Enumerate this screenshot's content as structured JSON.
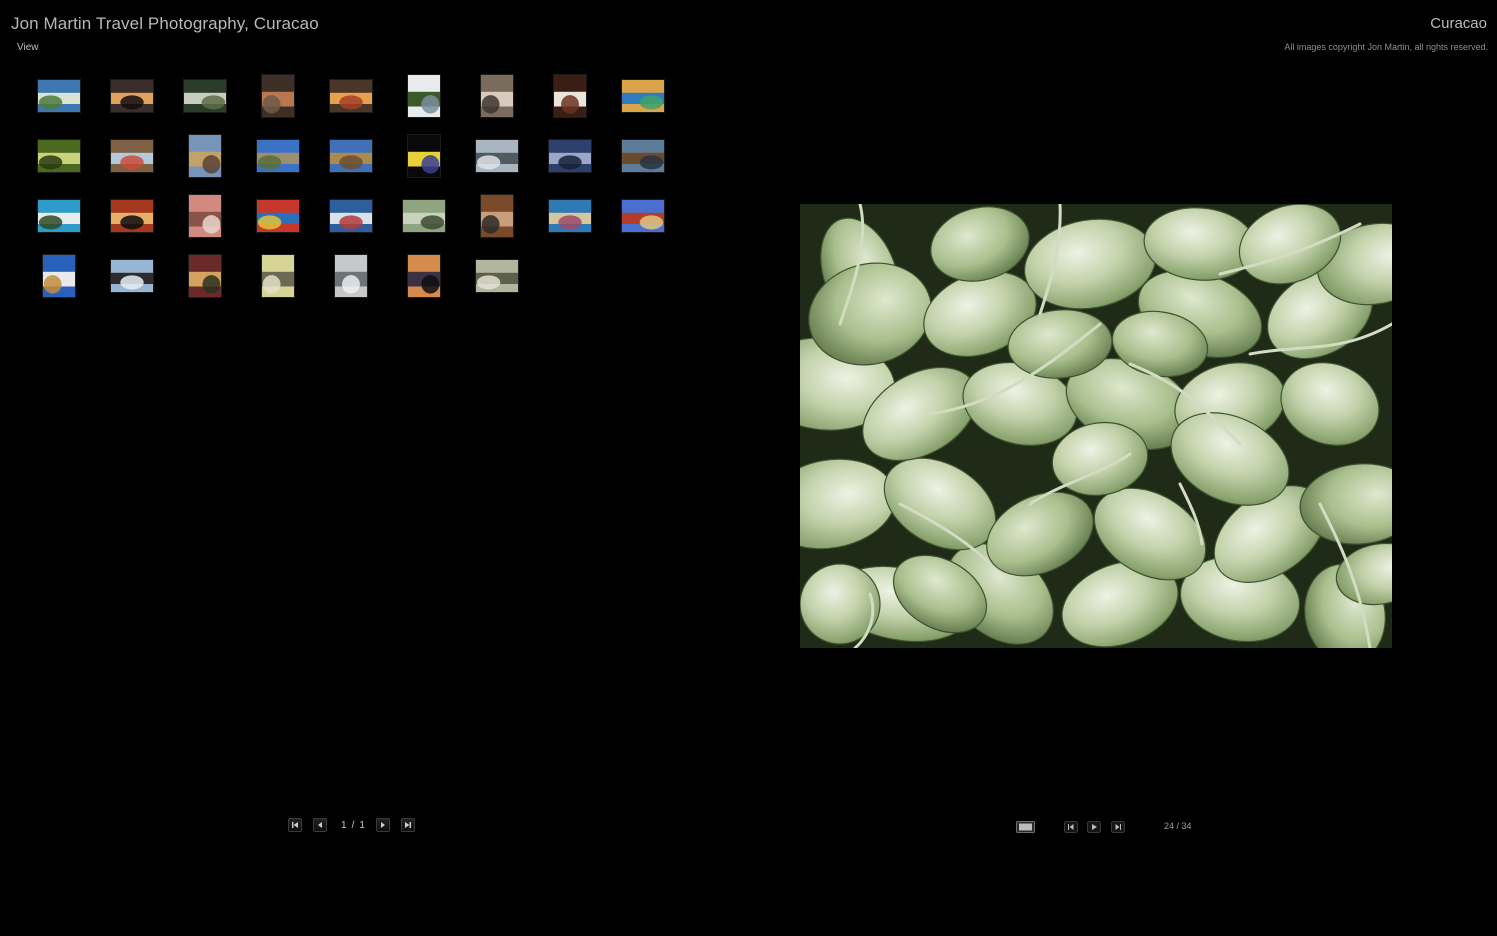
{
  "header": {
    "site_title": "Jon Martin Travel Photography, Curacao",
    "view_menu": "View",
    "gallery_title": "Curacao",
    "copyright": "All images copyright Jon Martin, all rights reserved."
  },
  "grid_pager": {
    "current_page": "1",
    "separator": "/",
    "total_pages": "1",
    "first_icon": "first-page-icon",
    "prev_icon": "previous-page-icon",
    "next_icon": "next-page-icon",
    "last_icon": "last-page-icon"
  },
  "viewer": {
    "counter": "24 / 34",
    "selected_index": 24,
    "total": 34,
    "mode_icon": "single-image-view-icon",
    "prev_icon": "previous-image-icon",
    "play_icon": "play-slideshow-icon",
    "next_icon": "next-image-icon"
  },
  "thumbnails": [
    {
      "shape": "landscape",
      "palette": [
        "#3f77b3",
        "#d9e4d0",
        "#4e7a3a"
      ]
    },
    {
      "shape": "landscape",
      "palette": [
        "#3a2e2c",
        "#e3a25b",
        "#120d0c"
      ]
    },
    {
      "shape": "landscape",
      "palette": [
        "#2c3c2a",
        "#c7cdbd",
        "#5d6b47"
      ]
    },
    {
      "shape": "portrait",
      "palette": [
        "#3d2f25",
        "#b9764f",
        "#6f5a48"
      ]
    },
    {
      "shape": "landscape",
      "palette": [
        "#4a3628",
        "#e6a14a",
        "#a63e2a"
      ]
    },
    {
      "shape": "portrait",
      "palette": [
        "#e8ebee",
        "#3b5a2c",
        "#7a8f9c"
      ]
    },
    {
      "shape": "portrait",
      "palette": [
        "#7a6b5c",
        "#d8cbbd",
        "#3f352e"
      ]
    },
    {
      "shape": "portrait",
      "palette": [
        "#3a1e16",
        "#e9e4dc",
        "#6b3322"
      ]
    },
    {
      "shape": "landscape",
      "palette": [
        "#d9a44a",
        "#2f7bbd",
        "#3da36b"
      ]
    },
    {
      "shape": "landscape",
      "palette": [
        "#4b6a1f",
        "#c9d37c",
        "#2a3a12"
      ]
    },
    {
      "shape": "landscape",
      "palette": [
        "#7e6045",
        "#b5c9db",
        "#c94b3a"
      ]
    },
    {
      "shape": "portrait",
      "palette": [
        "#7895b9",
        "#c3a26a",
        "#5b4333"
      ]
    },
    {
      "shape": "landscape",
      "palette": [
        "#3c72c6",
        "#9a8e73",
        "#5b6d3a"
      ]
    },
    {
      "shape": "landscape",
      "palette": [
        "#4071b8",
        "#a88a52",
        "#6b4f2c"
      ]
    },
    {
      "shape": "portrait",
      "palette": [
        "#090909",
        "#e7d23a",
        "#3a3e8f"
      ]
    },
    {
      "shape": "landscape",
      "palette": [
        "#a9b6c2",
        "#4f5a63",
        "#dfe3e6"
      ]
    },
    {
      "shape": "landscape",
      "palette": [
        "#2d3f6b",
        "#9aa7c8",
        "#18203a"
      ]
    },
    {
      "shape": "landscape",
      "palette": [
        "#5d7c99",
        "#6b4a2e",
        "#2a3341"
      ]
    },
    {
      "shape": "landscape",
      "palette": [
        "#2f9bc8",
        "#e6ecec",
        "#2d4a26"
      ]
    },
    {
      "shape": "landscape",
      "palette": [
        "#a4391f",
        "#e7b066",
        "#0d0d0d"
      ]
    },
    {
      "shape": "portrait",
      "palette": [
        "#d28a80",
        "#8a5348",
        "#e9d5cc"
      ]
    },
    {
      "shape": "landscape",
      "palette": [
        "#c7382c",
        "#2b6fb9",
        "#e0c33c"
      ]
    },
    {
      "shape": "landscape",
      "palette": [
        "#2c5f9b",
        "#d7e2ea",
        "#b23c3c"
      ]
    },
    {
      "shape": "landscape",
      "palette": [
        "#8fa57f",
        "#c8d3bb",
        "#3d4a32"
      ]
    },
    {
      "shape": "portrait",
      "palette": [
        "#7a4a2b",
        "#c7a07b",
        "#2c2a28"
      ]
    },
    {
      "shape": "landscape",
      "palette": [
        "#2f79b6",
        "#d7c79f",
        "#9a4a6b"
      ]
    },
    {
      "shape": "landscape",
      "palette": [
        "#4a6fd0",
        "#b33c28",
        "#e2c480"
      ]
    },
    {
      "shape": "portrait",
      "palette": [
        "#2960b9",
        "#e9e9e9",
        "#c38d3b"
      ]
    },
    {
      "shape": "landscape",
      "palette": [
        "#98b6d3",
        "#2c2c2c",
        "#e8eef2"
      ]
    },
    {
      "shape": "portrait",
      "palette": [
        "#6b2a2a",
        "#d3a35f",
        "#2a3320"
      ]
    },
    {
      "shape": "portrait",
      "palette": [
        "#d7d596",
        "#6b6b52",
        "#e3e0c7"
      ]
    },
    {
      "shape": "portrait",
      "palette": [
        "#c6c8ca",
        "#6d7378",
        "#eceff1"
      ]
    },
    {
      "shape": "portrait",
      "palette": [
        "#d68a4b",
        "#3b3140",
        "#0e0e12"
      ]
    },
    {
      "shape": "landscape",
      "palette": [
        "#b3b5a0",
        "#5c5f4a",
        "#e2e2d6"
      ]
    }
  ]
}
